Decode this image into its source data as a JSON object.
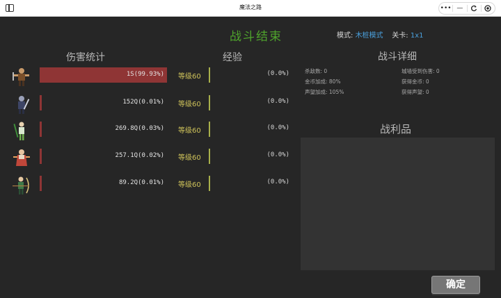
{
  "window": {
    "title": "魔法之路"
  },
  "header": {
    "title": "战斗结束",
    "mode_label": "模式:",
    "mode_value": "木桩模式",
    "stage_label": "关卡:",
    "stage_value": "1x1"
  },
  "sections": {
    "damage": "伤害统计",
    "exp": "经验",
    "battle_detail": "战斗详细",
    "loot": "战利品"
  },
  "heroes": [
    {
      "damage": "1S(99.93%)",
      "damage_fraction": 0.9993,
      "level": "等级60",
      "exp": "(0.0%)",
      "icon": "barbarian-warrior-icon"
    },
    {
      "damage": "152Q(0.01%)",
      "damage_fraction": 0.0001,
      "level": "等级60",
      "exp": "(0.0%)",
      "icon": "dark-knight-icon"
    },
    {
      "damage": "269.8Q(0.03%)",
      "damage_fraction": 0.0003,
      "level": "等级60",
      "exp": "(0.0%)",
      "icon": "elf-archer-icon"
    },
    {
      "damage": "257.1Q(0.02%)",
      "damage_fraction": 0.0002,
      "level": "等级60",
      "exp": "(0.0%)",
      "icon": "fire-mage-icon"
    },
    {
      "damage": "89.2Q(0.01%)",
      "damage_fraction": 0.0001,
      "level": "等级60",
      "exp": "(0.0%)",
      "icon": "ranger-icon"
    }
  ],
  "battle_detail": {
    "kills": "杀敌数: 0",
    "wall_damage": "城墙受到伤害: 0",
    "gold_bonus": "金币加成: 80%",
    "gold_earned": "获得金币: 0",
    "fame_bonus": "声望加成: 105%",
    "fame_earned": "获得声望: 0"
  },
  "buttons": {
    "confirm": "确定"
  },
  "colors": {
    "title_green": "#4fa42c",
    "mode_blue": "#4aa0dd",
    "damage_red": "#8f3535",
    "level_yellow": "#cfc35a",
    "background": "#262626"
  }
}
